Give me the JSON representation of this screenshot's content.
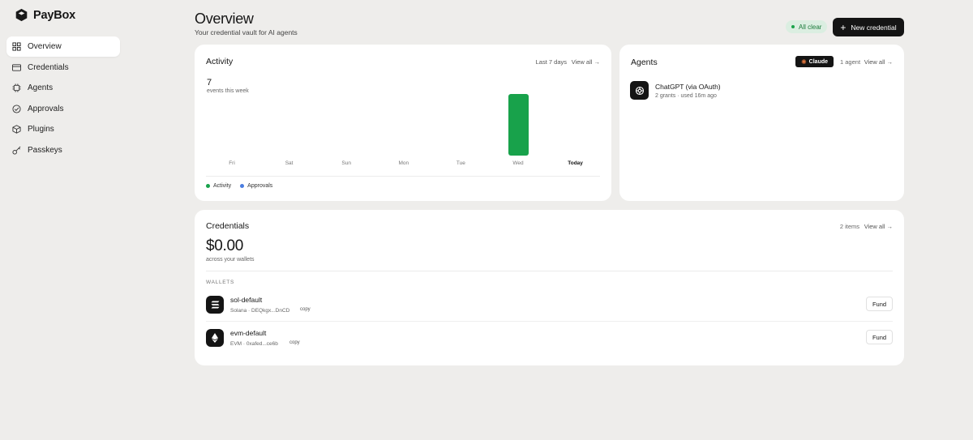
{
  "brand": {
    "name": "PayBox"
  },
  "sidebar": {
    "items": [
      {
        "label": "Overview",
        "icon": "grid-icon",
        "active": true
      },
      {
        "label": "Credentials",
        "icon": "card-icon"
      },
      {
        "label": "Agents",
        "icon": "chip-icon"
      },
      {
        "label": "Approvals",
        "icon": "check-circle-icon"
      },
      {
        "label": "Plugins",
        "icon": "cube-icon"
      },
      {
        "label": "Passkeys",
        "icon": "key-icon"
      }
    ]
  },
  "header": {
    "title": "Overview",
    "subtitle": "Your credential vault for AI agents",
    "status": "All clear",
    "new_button": "New credential"
  },
  "activity": {
    "title": "Activity",
    "range": "Last 7 days",
    "view_all": "View all →",
    "count": "7",
    "count_label": "events this week",
    "legend": [
      {
        "label": "Activity",
        "color": "#18a24b"
      },
      {
        "label": "Approvals",
        "color": "#4a7de0"
      }
    ]
  },
  "chart_data": {
    "type": "bar",
    "categories": [
      "Fri",
      "Sat",
      "Sun",
      "Mon",
      "Tue",
      "Wed",
      "Today"
    ],
    "values": [
      0,
      0,
      0,
      0,
      0,
      7,
      0
    ],
    "ylim": [
      0,
      7
    ]
  },
  "agents": {
    "title": "Agents",
    "pill": "Claude",
    "count": "1 agent",
    "view_all": "View all →",
    "list": [
      {
        "name": "ChatGPT (via OAuth)",
        "meta": "2 grants · used 16m ago"
      }
    ]
  },
  "credentials": {
    "title": "Credentials",
    "count": "2 items",
    "view_all": "View all →",
    "balance": "$0.00",
    "balance_label": "across your wallets",
    "wallets_label": "WALLETS",
    "wallets": [
      {
        "name": "sol-default",
        "addr": "Solana · DEQkgx...DnCD",
        "copy": "copy",
        "fund": "Fund"
      },
      {
        "name": "evm-default",
        "addr": "EVM · 0xafed...ce6b",
        "copy": "copy",
        "fund": "Fund"
      }
    ]
  }
}
